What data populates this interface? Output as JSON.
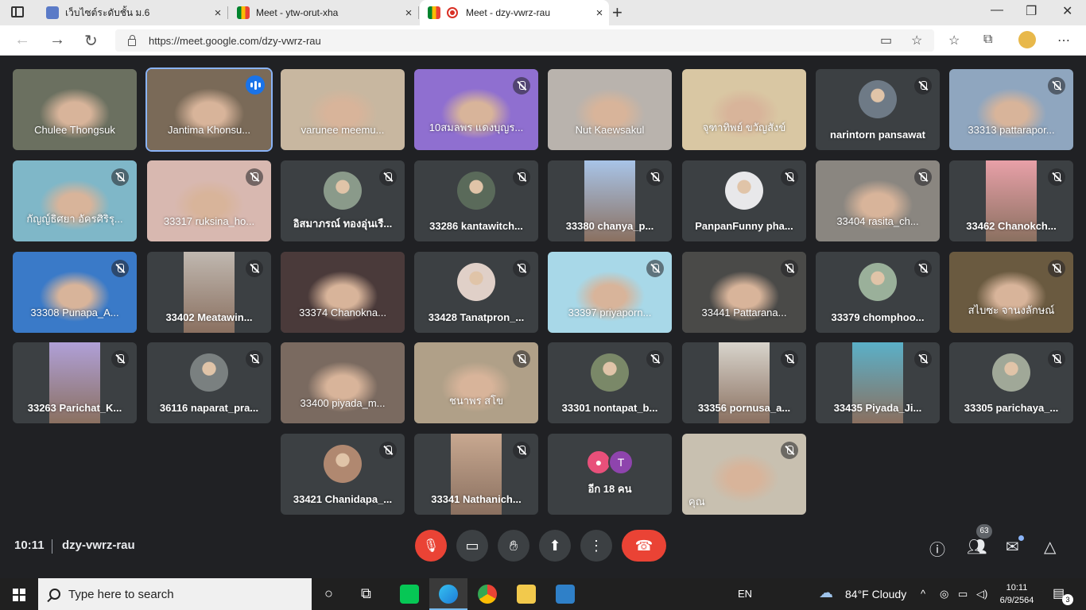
{
  "browser": {
    "tabs": [
      {
        "title": "เว็บไซต์ระดับชั้น ม.6",
        "close": "×"
      },
      {
        "title": "Meet - ytw-orut-xha",
        "close": "×"
      },
      {
        "title": "Meet - dzy-vwrz-rau",
        "close": "×"
      }
    ],
    "new_tab": "+",
    "url": "https://meet.google.com/dzy-vwrz-rau"
  },
  "meet": {
    "time": "10:11",
    "meeting_code": "dzy-vwrz-rau",
    "participant_count": "63",
    "more_label": "อีก 18 คน",
    "more_initial": "T",
    "participants": [
      {
        "name": "Chulee Thongsuk",
        "muted": false,
        "kind": "video",
        "color": "#6b7060"
      },
      {
        "name": "Jantima Khonsu...",
        "muted": false,
        "kind": "video",
        "color": "#7a6a58",
        "speaking": true
      },
      {
        "name": "varunee meemu...",
        "muted": false,
        "kind": "video",
        "color": "#c8b7a0"
      },
      {
        "name": "10สมลพร แดงบุญร...",
        "muted": true,
        "kind": "video",
        "color": "#8f6fd0"
      },
      {
        "name": "Nut Kaewsakul",
        "muted": false,
        "kind": "video",
        "color": "#b9b3ad"
      },
      {
        "name": "จุฑาทิพย์ ขวัญสังข์",
        "muted": false,
        "kind": "video",
        "color": "#d9c7a3"
      },
      {
        "name": "narintorn pansawat",
        "muted": true,
        "kind": "avatar",
        "color": "#6e7a86"
      },
      {
        "name": "33313 pattarapor...",
        "muted": true,
        "kind": "video",
        "color": "#8fa6bf"
      },
      {
        "name": "กัญญ์ธิศยา อัครศิริรุ...",
        "muted": true,
        "kind": "video",
        "color": "#7fb7c8"
      },
      {
        "name": "33317 ruksina_ho...",
        "muted": true,
        "kind": "video",
        "color": "#d8b8b0"
      },
      {
        "name": "อิสมาภรณ์ ทองอุ่นเรื...",
        "muted": true,
        "kind": "avatar",
        "color": "#8a9a8a"
      },
      {
        "name": "33286 kantawitch...",
        "muted": true,
        "kind": "avatar",
        "color": "#5a6a5a"
      },
      {
        "name": "33380 chanya_p...",
        "muted": true,
        "kind": "portrait",
        "color": "#a8c4e8"
      },
      {
        "name": "PanpanFunny pha...",
        "muted": true,
        "kind": "avatar",
        "color": "#e8e8ea"
      },
      {
        "name": "33404 rasita_ch...",
        "muted": true,
        "kind": "video",
        "color": "#8a8680"
      },
      {
        "name": "33462 Chanokch...",
        "muted": true,
        "kind": "portrait",
        "color": "#e8a0a8"
      },
      {
        "name": "33308 Punapa_A...",
        "muted": true,
        "kind": "video",
        "color": "#3a7ac8"
      },
      {
        "name": "33402 Meatawin...",
        "muted": true,
        "kind": "portrait",
        "color": "#c0b8b0"
      },
      {
        "name": "33374 Chanokna...",
        "muted": false,
        "kind": "video",
        "color": "#4a3a3a"
      },
      {
        "name": "33428 Tanatpron_...",
        "muted": true,
        "kind": "avatar",
        "color": "#e0d0c8"
      },
      {
        "name": "33397 priyaporn...",
        "muted": true,
        "kind": "video",
        "color": "#a8d8e8"
      },
      {
        "name": "33441 Pattarana...",
        "muted": true,
        "kind": "video",
        "color": "#4a4a48"
      },
      {
        "name": "33379 chomphoo...",
        "muted": true,
        "kind": "avatar",
        "color": "#9ab09a"
      },
      {
        "name": "สไบซะ จานงลักษณ์",
        "muted": true,
        "kind": "video",
        "color": "#6a5a40"
      },
      {
        "name": "33263 Parichat_K...",
        "muted": true,
        "kind": "portrait",
        "color": "#b0a0d8"
      },
      {
        "name": "36116 naparat_pra...",
        "muted": true,
        "kind": "avatar",
        "color": "#7a8080"
      },
      {
        "name": "33400 piyada_m...",
        "muted": false,
        "kind": "video",
        "color": "#7a6a60"
      },
      {
        "name": "ชนาพร สโข",
        "muted": true,
        "kind": "video",
        "color": "#b0a088"
      },
      {
        "name": "33301 nontapat_b...",
        "muted": true,
        "kind": "avatar",
        "color": "#7a8868"
      },
      {
        "name": "33356 pornusa_a...",
        "muted": true,
        "kind": "portrait",
        "color": "#d8d4cc"
      },
      {
        "name": "33435 Piyada_Ji...",
        "muted": true,
        "kind": "portrait",
        "color": "#5ab0c8"
      },
      {
        "name": "33305 parichaya_...",
        "muted": true,
        "kind": "avatar",
        "color": "#a0a898"
      },
      {
        "name": "33421 Chanidapa_...",
        "muted": true,
        "kind": "avatar",
        "color": "#b08870"
      },
      {
        "name": "33341 Nathanich...",
        "muted": true,
        "kind": "portrait",
        "color": "#c8a890"
      },
      {
        "name": "คุณ",
        "muted": true,
        "kind": "self",
        "color": "#c8c0b0"
      }
    ]
  },
  "taskbar": {
    "search_placeholder": "Type here to search",
    "language": "EN",
    "weather": "84°F  Cloudy",
    "clock_time": "10:11",
    "clock_date": "6/9/2564",
    "notifications": "3"
  }
}
